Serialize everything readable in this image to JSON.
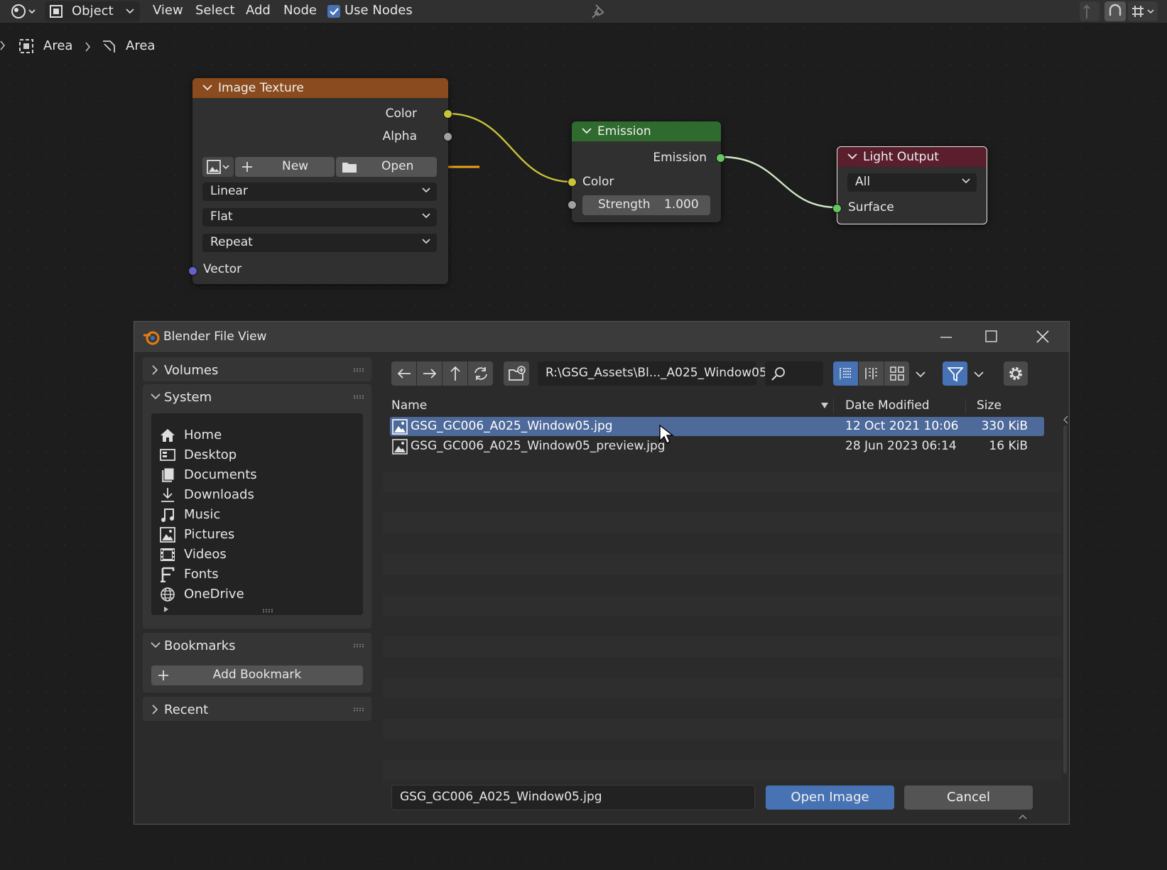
{
  "header": {
    "mode_label": "Object",
    "menu": [
      "View",
      "Select",
      "Add",
      "Node"
    ],
    "use_nodes_label": "Use Nodes",
    "use_nodes_checked": true
  },
  "breadcrumb": [
    "Area",
    "Area"
  ],
  "nodes": {
    "image_texture": {
      "title": "Image Texture",
      "outputs": [
        "Color",
        "Alpha"
      ],
      "new_label": "New",
      "open_label": "Open",
      "interpolation": "Linear",
      "projection": "Flat",
      "extension": "Repeat",
      "input": "Vector"
    },
    "emission": {
      "title": "Emission",
      "output": "Emission",
      "color_label": "Color",
      "strength_label": "Strength",
      "strength_value": "1.000"
    },
    "light_output": {
      "title": "Light Output",
      "target": "All",
      "input": "Surface"
    }
  },
  "dialog": {
    "title": "Blender File View",
    "sidebar": {
      "volumes": "Volumes",
      "system": "System",
      "system_items": [
        {
          "label": "Home",
          "icon": "home-icon"
        },
        {
          "label": "Desktop",
          "icon": "desktop-icon"
        },
        {
          "label": "Documents",
          "icon": "documents-icon"
        },
        {
          "label": "Downloads",
          "icon": "downloads-icon"
        },
        {
          "label": "Music",
          "icon": "music-icon"
        },
        {
          "label": "Pictures",
          "icon": "pictures-icon"
        },
        {
          "label": "Videos",
          "icon": "videos-icon"
        },
        {
          "label": "Fonts",
          "icon": "fonts-icon"
        },
        {
          "label": "OneDrive",
          "icon": "globe-icon"
        }
      ],
      "bookmarks": "Bookmarks",
      "add_bookmark": "Add Bookmark",
      "recent": "Recent"
    },
    "path": "R:\\GSG_Assets\\Bl..._A025_Window05\\",
    "columns": {
      "name": "Name",
      "date": "Date Modified",
      "size": "Size"
    },
    "files": [
      {
        "name": "GSG_GC006_A025_Window05.jpg",
        "date": "12 Oct 2021 10:06",
        "size": "330 KiB",
        "selected": true
      },
      {
        "name": "GSG_GC006_A025_Window05_preview.jpg",
        "date": "28 Jun 2023 06:14",
        "size": "16 KiB",
        "selected": false
      }
    ],
    "filename": "GSG_GC006_A025_Window05.jpg",
    "open_button": "Open Image",
    "cancel_button": "Cancel"
  },
  "colors": {
    "accent_blue": "#4772b3",
    "image_texture_header": "#8a4c1e",
    "emission_header": "#2f6a2f",
    "light_output_header": "#5a1e2c",
    "annotation_arrow": "#f0a21a"
  }
}
